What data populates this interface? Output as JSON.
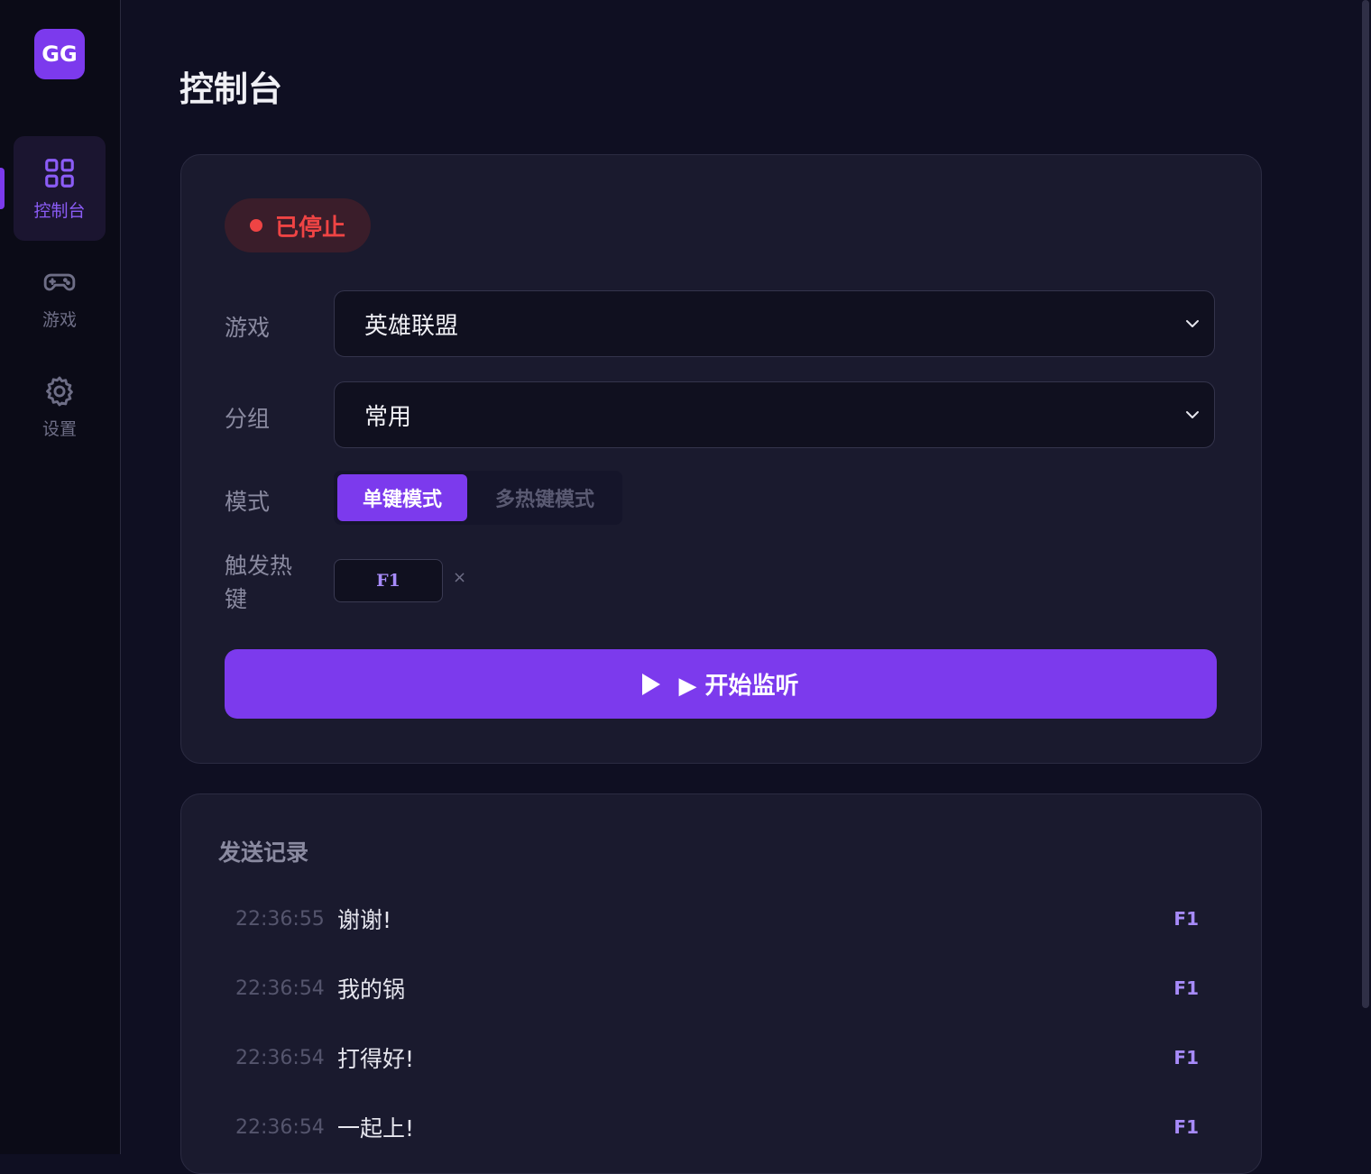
{
  "app": {
    "logo_text": "GG"
  },
  "sidebar": {
    "items": [
      {
        "label": "控制台",
        "icon": "grid-icon",
        "active": true
      },
      {
        "label": "游戏",
        "icon": "gamepad-icon",
        "active": false
      },
      {
        "label": "设置",
        "icon": "gear-icon",
        "active": false
      }
    ]
  },
  "page": {
    "title": "控制台"
  },
  "control": {
    "status": "已停止",
    "game_label": "游戏",
    "game_value": "英雄联盟",
    "group_label": "分组",
    "group_value": "常用",
    "mode_label": "模式",
    "mode_options": [
      "单键模式",
      "多热键模式"
    ],
    "mode_selected": "单键模式",
    "hotkey_label": "触发热键",
    "hotkey_value": "F1",
    "hotkey_remove": "×",
    "start_label": "▶ 开始监听"
  },
  "log": {
    "title": "发送记录",
    "entries": [
      {
        "time": "22:36:55",
        "message": "谢谢!",
        "key": "F1"
      },
      {
        "time": "22:36:54",
        "message": "我的锅",
        "key": "F1"
      },
      {
        "time": "22:36:54",
        "message": "打得好!",
        "key": "F1"
      },
      {
        "time": "22:36:54",
        "message": "一起上!",
        "key": "F1"
      }
    ]
  },
  "colors": {
    "accent": "#7c3aed",
    "status_stopped": "#ef4444",
    "background": "#0f0f22",
    "card": "#1a1a2e"
  }
}
